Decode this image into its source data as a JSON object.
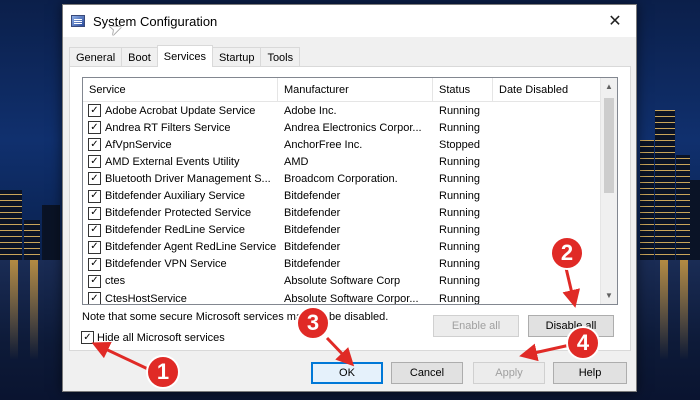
{
  "window": {
    "title": "System Configuration",
    "close_glyph": "✕"
  },
  "tabs": [
    {
      "label": "General"
    },
    {
      "label": "Boot"
    },
    {
      "label": "Services",
      "active": true
    },
    {
      "label": "Startup"
    },
    {
      "label": "Tools"
    }
  ],
  "columns": {
    "service": "Service",
    "manufacturer": "Manufacturer",
    "status": "Status",
    "date_disabled": "Date Disabled"
  },
  "services": [
    {
      "name": "Adobe Acrobat Update Service",
      "manufacturer": "Adobe Inc.",
      "status": "Running",
      "checked": true
    },
    {
      "name": "Andrea RT Filters Service",
      "manufacturer": "Andrea Electronics Corpor...",
      "status": "Running",
      "checked": true
    },
    {
      "name": "AfVpnService",
      "manufacturer": "AnchorFree Inc.",
      "status": "Stopped",
      "checked": true
    },
    {
      "name": "AMD External Events Utility",
      "manufacturer": "AMD",
      "status": "Running",
      "checked": true
    },
    {
      "name": "Bluetooth Driver Management S...",
      "manufacturer": "Broadcom Corporation.",
      "status": "Running",
      "checked": true
    },
    {
      "name": "Bitdefender Auxiliary Service",
      "manufacturer": "Bitdefender",
      "status": "Running",
      "checked": true
    },
    {
      "name": "Bitdefender Protected Service",
      "manufacturer": "Bitdefender",
      "status": "Running",
      "checked": true
    },
    {
      "name": "Bitdefender RedLine Service",
      "manufacturer": "Bitdefender",
      "status": "Running",
      "checked": true
    },
    {
      "name": "Bitdefender Agent RedLine Service",
      "manufacturer": "Bitdefender",
      "status": "Running",
      "checked": true
    },
    {
      "name": "Bitdefender VPN Service",
      "manufacturer": "Bitdefender",
      "status": "Running",
      "checked": true
    },
    {
      "name": "ctes",
      "manufacturer": "Absolute Software Corp",
      "status": "Running",
      "checked": true
    },
    {
      "name": "CtesHostService",
      "manufacturer": "Absolute Software Corpor...",
      "status": "Running",
      "checked": true
    }
  ],
  "note": "Note that some secure Microsoft services may not be disabled.",
  "buttons": {
    "enable_all": "Enable all",
    "disable_all": "Disable all",
    "ok": "OK",
    "cancel": "Cancel",
    "apply": "Apply",
    "help": "Help"
  },
  "hide_ms": {
    "label": "Hide all Microsoft services",
    "checked": true
  },
  "annotations": [
    "1",
    "2",
    "3",
    "4"
  ],
  "colors": {
    "annotation": "#e02a26",
    "focus_border": "#0078d7"
  },
  "icons": {
    "check": "✓",
    "scroll_up": "▲",
    "scroll_down": "▼"
  }
}
